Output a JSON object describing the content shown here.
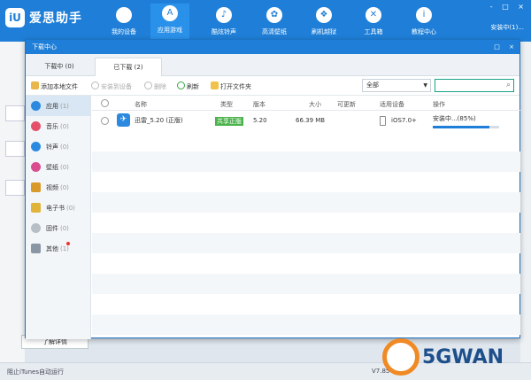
{
  "app": {
    "name": "爱思助手",
    "logo": "iU"
  },
  "nav": [
    {
      "label": "我的设备",
      "icon": "apple-icon",
      "glyph": ""
    },
    {
      "label": "应用游戏",
      "icon": "appstore-icon",
      "glyph": "A"
    },
    {
      "label": "酷炫铃声",
      "icon": "bell-icon",
      "glyph": "♪"
    },
    {
      "label": "高清壁纸",
      "icon": "flower-icon",
      "glyph": "✿"
    },
    {
      "label": "刷机越狱",
      "icon": "dropbox-icon",
      "glyph": "❖"
    },
    {
      "label": "工具箱",
      "icon": "tools-icon",
      "glyph": "✕"
    },
    {
      "label": "教程中心",
      "icon": "info-icon",
      "glyph": "i"
    }
  ],
  "header": {
    "device_status": "安装中(1)...",
    "win_controls": [
      "-",
      "□",
      "×"
    ]
  },
  "dialog": {
    "title": "下载中心",
    "controls": [
      "□",
      "×"
    ],
    "tabs": [
      {
        "label": "下载中 (0)"
      },
      {
        "label": "已下载 (2)"
      }
    ],
    "toolbar": {
      "add_local": "添加本地文件",
      "install_device": "安装到设备",
      "delete": "删除",
      "refresh": "刷新",
      "open_folder": "打开文件夹"
    },
    "filter": {
      "selected": "全部",
      "arrow": "▼"
    },
    "search": {
      "placeholder": "",
      "icon": "search-icon",
      "glyph": "⌕"
    }
  },
  "sidebar": [
    {
      "label": "应用",
      "count": "(1)",
      "icon": "app-icon",
      "color": "#2b8ae0"
    },
    {
      "label": "音乐",
      "count": "(0)",
      "icon": "music-icon",
      "color": "#e4506a"
    },
    {
      "label": "铃声",
      "count": "(0)",
      "icon": "bell-icon",
      "color": "#2b8ae0"
    },
    {
      "label": "壁纸",
      "count": "(0)",
      "icon": "wallpaper-icon",
      "color": "#d94d8f"
    },
    {
      "label": "视频",
      "count": "(0)",
      "icon": "video-icon",
      "color": "#d99a2b"
    },
    {
      "label": "电子书",
      "count": "(0)",
      "icon": "ebook-icon",
      "color": "#e0b43a"
    },
    {
      "label": "固件",
      "count": "(0)",
      "icon": "firmware-icon",
      "color": "#b8bec6"
    },
    {
      "label": "其他",
      "count": "(1)",
      "icon": "other-icon",
      "color": "#8a96a3"
    }
  ],
  "table": {
    "columns": [
      "名称",
      "类型",
      "版本",
      "大小",
      "可更新",
      "适用设备",
      "操作"
    ],
    "rows": [
      {
        "name": "迅雷_5.20 (正版)",
        "type": "共享正版",
        "version": "5.20",
        "size": "66.39 MB",
        "updatable": "",
        "device": "iOS7.0+",
        "action": "安装中...(85%)",
        "progress": 0.85
      }
    ]
  },
  "bg": {
    "learn_more": "了解详情",
    "itunes_status": "阻止iTunes自动运行",
    "version": "V7.85"
  },
  "watermark": {
    "text": "5GWAN"
  },
  "colors": {
    "primary": "#1f7fd8",
    "tag_green": "#4bb34b",
    "search_border": "#19a28a",
    "brand_orange": "#f08a24"
  }
}
